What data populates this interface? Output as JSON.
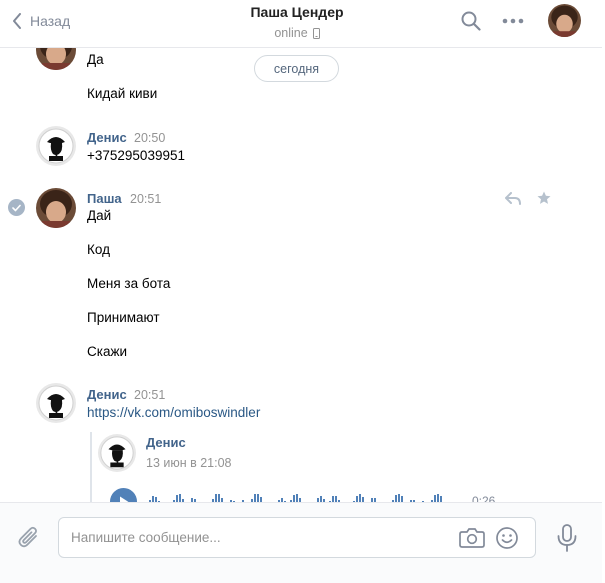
{
  "header": {
    "back_label": "Назад",
    "title": "Паша Цендер",
    "status": "online"
  },
  "chat": {
    "date_divider": "сегодня",
    "group1": {
      "messages": [
        "Да",
        "Кидай киви"
      ]
    },
    "group2": {
      "author": "Денис",
      "time": "20:50",
      "messages": [
        "+375295039951"
      ]
    },
    "group3": {
      "author": "Паша",
      "time": "20:51",
      "messages": [
        "Дай",
        "Код",
        "Меня за бота",
        "Принимают",
        "Скажи"
      ]
    },
    "group4": {
      "author": "Денис",
      "time": "20:51",
      "link": "https://vk.com/omiboswindler",
      "forwarded": {
        "author": "Денис",
        "date": "13 июн в 21:08",
        "voice_duration": "0:26"
      }
    }
  },
  "composer": {
    "placeholder": "Напишите сообщение..."
  },
  "colors": {
    "accent": "#5181b8",
    "author": "#42648b",
    "link": "#2a5885",
    "muted": "#939393"
  },
  "icons": [
    "back-chevron-icon",
    "phone-icon",
    "search-icon",
    "more-icon",
    "check-icon",
    "reply-icon",
    "star-icon",
    "play-icon",
    "paperclip-icon",
    "camera-icon",
    "smile-icon",
    "microphone-icon"
  ]
}
